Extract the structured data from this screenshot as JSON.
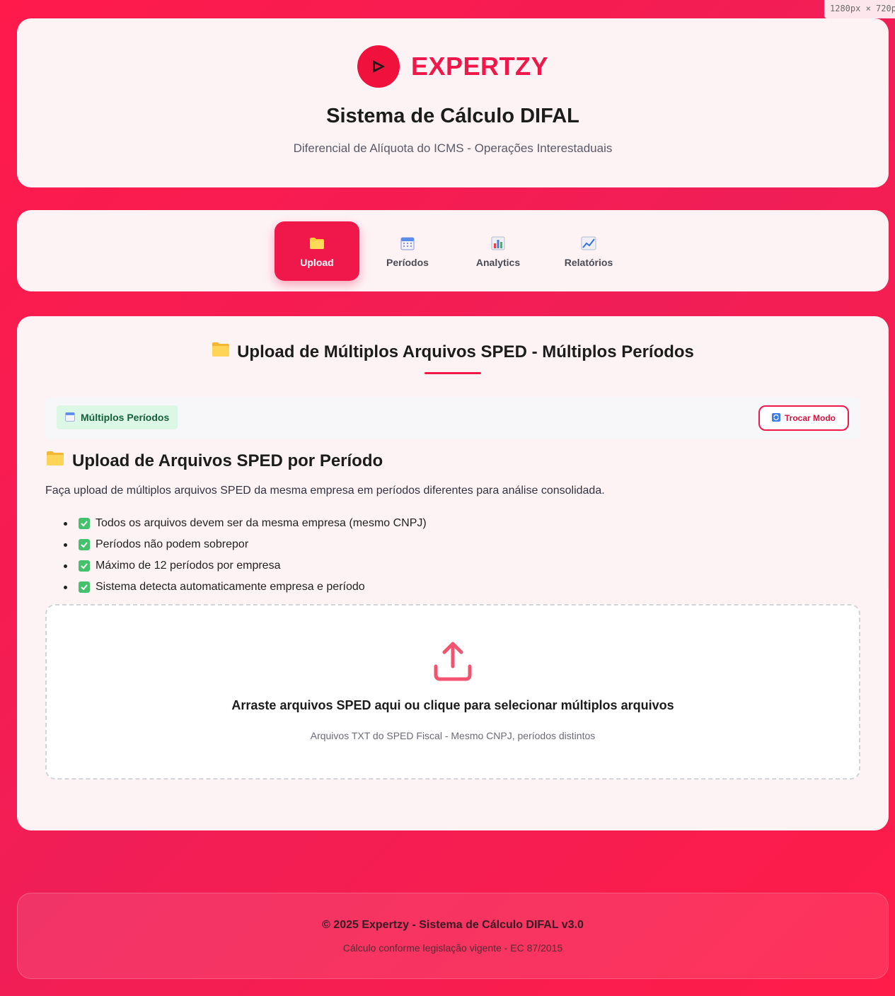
{
  "viewport_badge": "1280px × 720px",
  "header": {
    "brand": "EXPERTZY",
    "title": "Sistema de Cálculo DIFAL",
    "subtitle": "Diferencial de Alíquota do ICMS - Operações Interestaduais"
  },
  "nav": {
    "tabs": [
      {
        "label": "Upload",
        "icon": "folder-icon",
        "active": true
      },
      {
        "label": "Períodos",
        "icon": "calendar-icon",
        "active": false
      },
      {
        "label": "Analytics",
        "icon": "bar-chart-icon",
        "active": false
      },
      {
        "label": "Relatórios",
        "icon": "trend-chart-icon",
        "active": false
      }
    ]
  },
  "main": {
    "title": "Upload de Múltiplos Arquivos SPED - Múltiplos Períodos",
    "mode_badge": "Múltiplos Períodos",
    "switch_button": "Trocar Modo",
    "section_title": "Upload de Arquivos SPED por Período",
    "description": "Faça upload de múltiplos arquivos SPED da mesma empresa em períodos diferentes para análise consolidada.",
    "rules": [
      "Todos os arquivos devem ser da mesma empresa (mesmo CNPJ)",
      "Períodos não podem sobrepor",
      "Máximo de 12 períodos por empresa",
      "Sistema detecta automaticamente empresa e período"
    ],
    "dropzone": {
      "main_text": "Arraste arquivos SPED aqui ou clique para selecionar múltiplos arquivos",
      "sub_text": "Arquivos TXT do SPED Fiscal - Mesmo CNPJ, períodos distintos"
    }
  },
  "footer": {
    "main": "© 2025 Expertzy - Sistema de Cálculo DIFAL v3.0",
    "sub": "Cálculo conforme legislação vigente - EC 87/2015"
  },
  "colors": {
    "accent": "#f0174a",
    "background": "#ff1a4b",
    "card": "#fdf3f5",
    "success_badge": "#dcf7e6"
  }
}
